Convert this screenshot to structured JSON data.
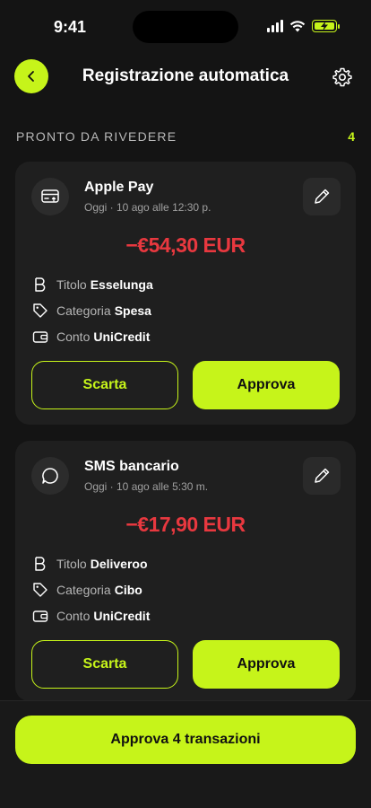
{
  "status": {
    "time": "9:41"
  },
  "header": {
    "title": "Registrazione automatica"
  },
  "section": {
    "title": "PRONTO DA RIVEDERE",
    "count": "4"
  },
  "transactions": [
    {
      "source": "Apple Pay",
      "source_icon": "card-icon",
      "date": "Oggi · 10 ago alle 12:30 p.",
      "amount": "−€54,30 EUR",
      "title_label": "Titolo",
      "title_value": "Esselunga",
      "category_label": "Categoria",
      "category_value": "Spesa",
      "account_label": "Conto",
      "account_value": "UniCredit",
      "discard_label": "Scarta",
      "approve_label": "Approva"
    },
    {
      "source": "SMS bancario",
      "source_icon": "message-icon",
      "date": "Oggi · 10 ago alle 5:30 m.",
      "amount": "−€17,90 EUR",
      "title_label": "Titolo",
      "title_value": "Deliveroo",
      "category_label": "Categoria",
      "category_value": "Cibo",
      "account_label": "Conto",
      "account_value": "UniCredit",
      "discard_label": "Scarta",
      "approve_label": "Approva"
    }
  ],
  "footer": {
    "approve_all_label": "Approva 4 transazioni"
  },
  "colors": {
    "accent": "#c6f41a",
    "negative": "#e8383f",
    "background": "#141414",
    "card": "#1f1f1f"
  }
}
